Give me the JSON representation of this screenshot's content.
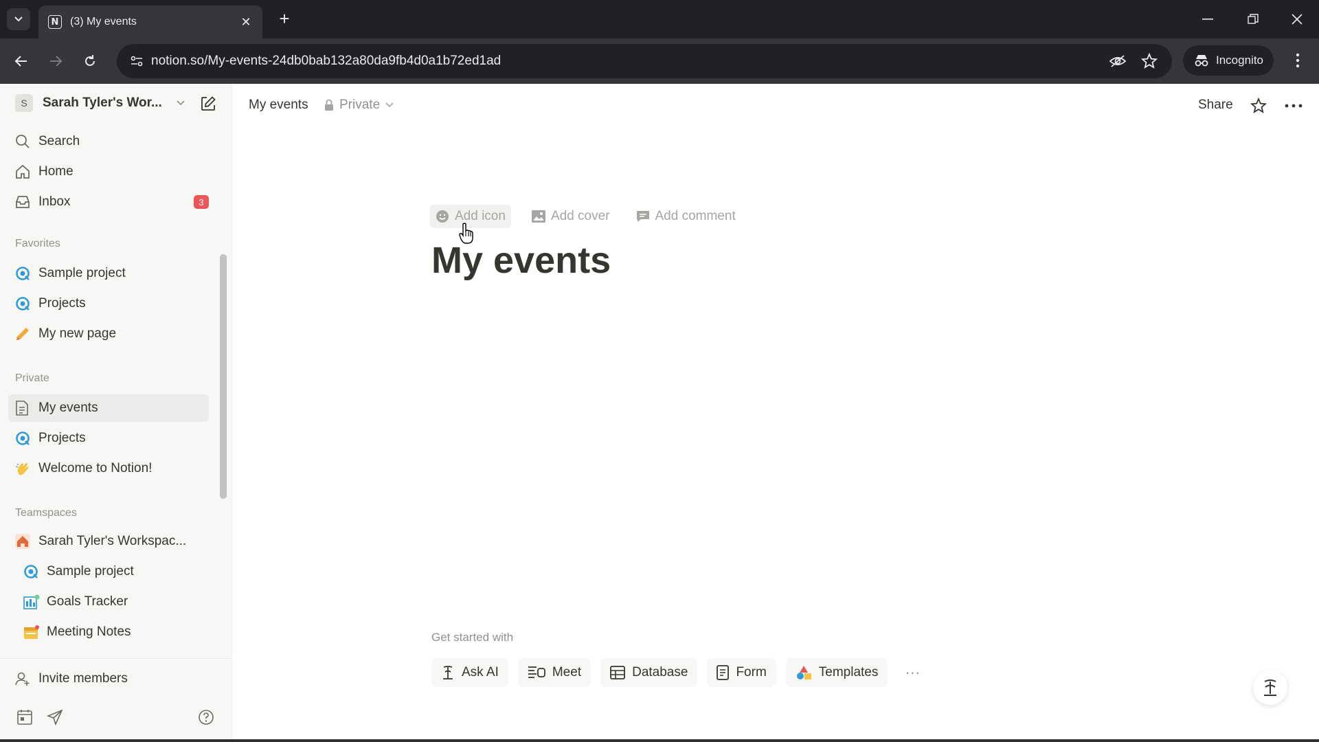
{
  "browser": {
    "tab_title": "(3) My events",
    "tab_favicon": "N",
    "url": "notion.so/My-events-24db0bab132a80da9fb4d0a1b72ed1ad",
    "incognito_label": "Incognito"
  },
  "sidebar": {
    "workspace_initial": "S",
    "workspace_name": "Sarah Tyler's Wor...",
    "top_items": [
      {
        "label": "Search",
        "icon": "search-icon"
      },
      {
        "label": "Home",
        "icon": "home-icon"
      },
      {
        "label": "Inbox",
        "icon": "inbox-icon",
        "badge": "3"
      }
    ],
    "favorites_label": "Favorites",
    "favorites": [
      {
        "label": "Sample project",
        "icon": "project-icon"
      },
      {
        "label": "Projects",
        "icon": "project-icon"
      },
      {
        "label": "My new page",
        "icon": "pencil-icon"
      }
    ],
    "private_label": "Private",
    "private": [
      {
        "label": "My events",
        "icon": "page-icon",
        "active": true
      },
      {
        "label": "Projects",
        "icon": "project-icon"
      },
      {
        "label": "Welcome to Notion!",
        "icon": "wave-icon"
      }
    ],
    "teamspaces_label": "Teamspaces",
    "teamspace_name": "Sarah Tyler's Workspac...",
    "teamspace_items": [
      {
        "label": "Sample project",
        "icon": "project-icon"
      },
      {
        "label": "Goals Tracker",
        "icon": "goals-icon"
      },
      {
        "label": "Meeting Notes",
        "icon": "calendar-icon"
      }
    ],
    "invite_label": "Invite members"
  },
  "header": {
    "breadcrumb": "My events",
    "privacy": "Private",
    "share_label": "Share"
  },
  "page": {
    "add_icon": "Add icon",
    "add_cover": "Add cover",
    "add_comment": "Add comment",
    "title": "My events",
    "get_started_label": "Get started with",
    "quick_actions": [
      {
        "label": "Ask AI",
        "icon": "ai-icon"
      },
      {
        "label": "Meet",
        "icon": "meet-icon"
      },
      {
        "label": "Database",
        "icon": "table-icon"
      },
      {
        "label": "Form",
        "icon": "form-icon"
      },
      {
        "label": "Templates",
        "icon": "templates-icon"
      }
    ],
    "more_label": "···"
  },
  "colors": {
    "badge": "#eb5757",
    "sidebar_bg": "#f7f7f5",
    "project_icon": "#2e9bd6",
    "text_primary": "#37352f",
    "text_muted": "#91918e"
  }
}
